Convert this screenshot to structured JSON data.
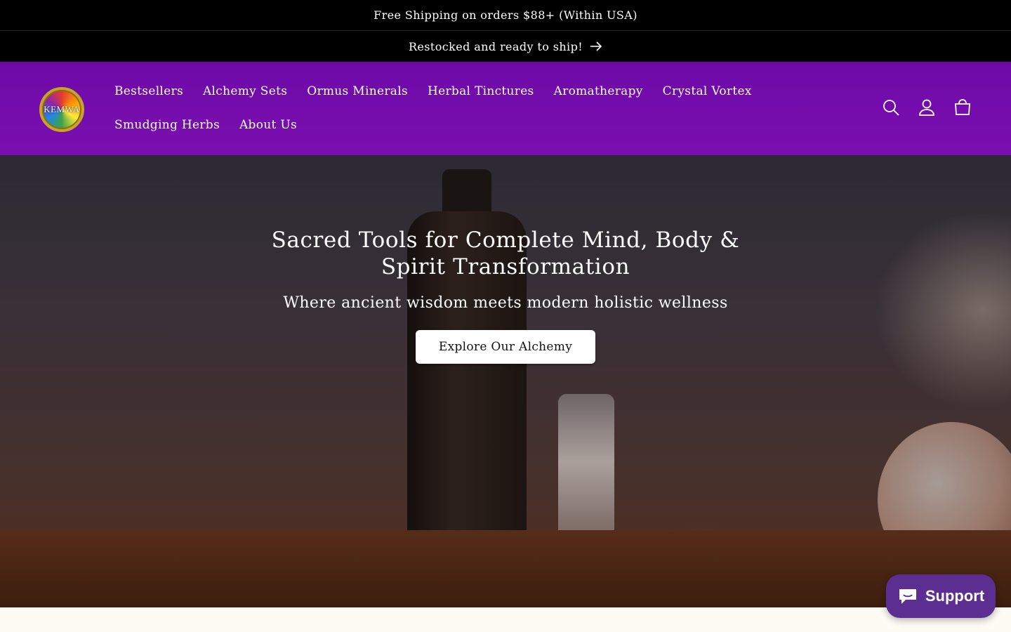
{
  "announcement": {
    "text": "Free Shipping on orders $88+ (Within USA)"
  },
  "announcement2": {
    "text": "Restocked and ready to ship!"
  },
  "brand": {
    "logo_text": "KEMWA"
  },
  "nav": {
    "items": [
      {
        "label": "Bestsellers"
      },
      {
        "label": "Alchemy Sets"
      },
      {
        "label": "Ormus Minerals"
      },
      {
        "label": "Herbal Tinctures"
      },
      {
        "label": "Aromatherapy"
      },
      {
        "label": "Crystal Vortex"
      },
      {
        "label": "Smudging Herbs"
      },
      {
        "label": "About Us"
      }
    ],
    "icons": [
      "search-icon",
      "account-icon",
      "cart-icon"
    ]
  },
  "hero": {
    "title": "Sacred Tools for Complete Mind, Body & Spirit Transformation",
    "subtitle": "Where ancient wisdom meets modern holistic wellness",
    "button_label": "Explore Our Alchemy"
  },
  "chat": {
    "label": "Support"
  },
  "colors": {
    "nav_bg": "#7b0fb0",
    "announcement_bg": "#000000",
    "chat_bg": "#5c2e91",
    "page_bg": "#fdfbf3"
  }
}
